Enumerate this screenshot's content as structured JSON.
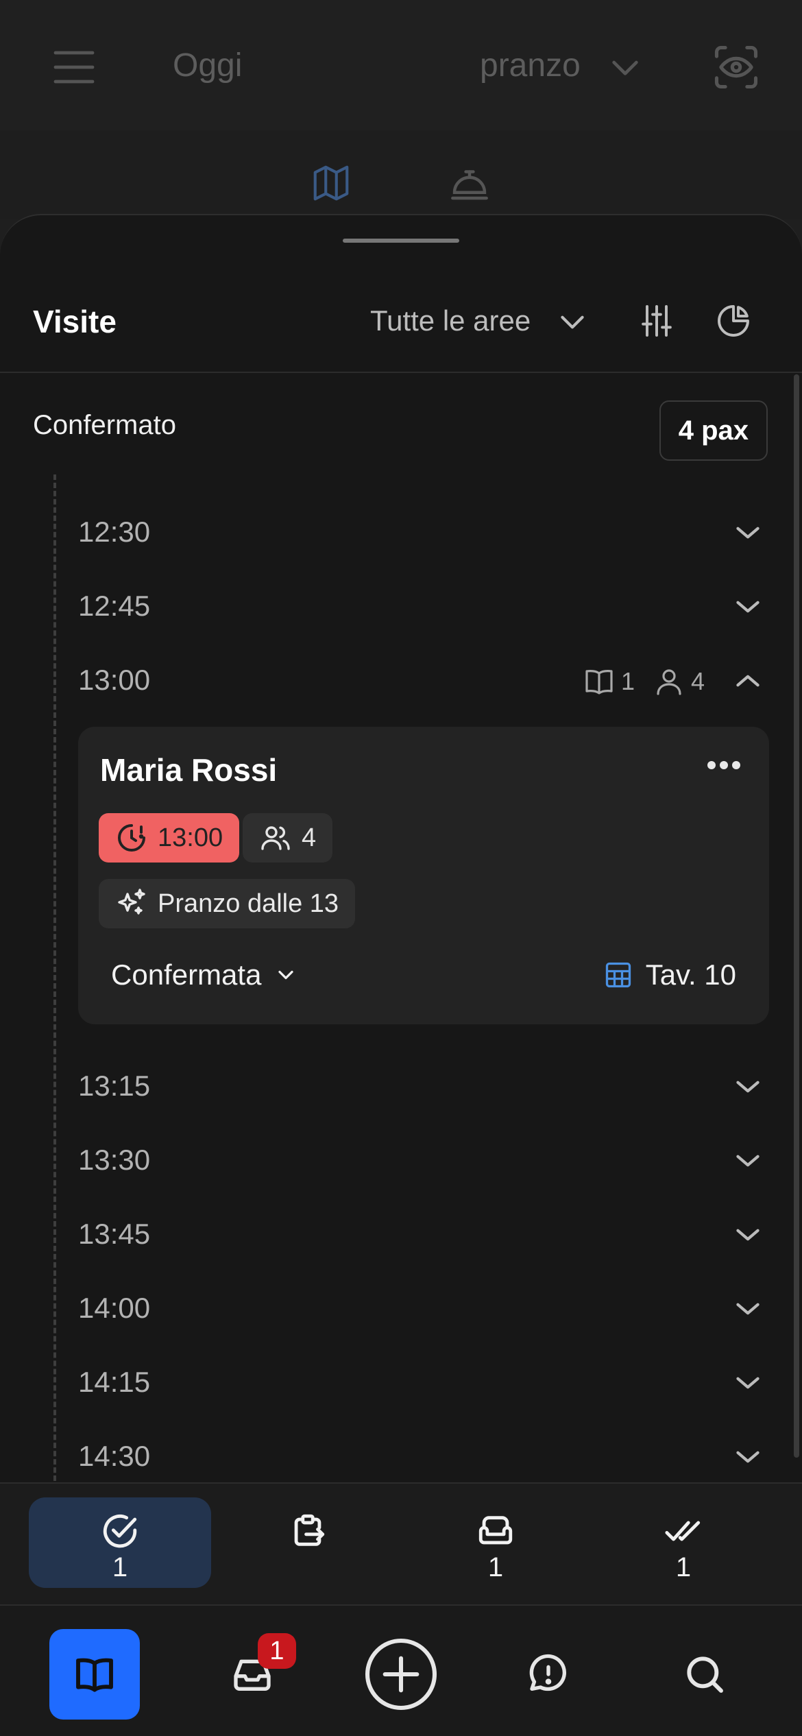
{
  "header": {
    "day_label": "Oggi",
    "service_label": "pranzo"
  },
  "sheet": {
    "title": "Visite",
    "area_filter": "Tutte le aree",
    "status_label": "Confermato",
    "pax_label": "4 pax"
  },
  "slots": [
    {
      "time": "12:30"
    },
    {
      "time": "12:45"
    },
    {
      "time": "13:00",
      "bookings": "1",
      "guests": "4"
    },
    {
      "time": "13:15"
    },
    {
      "time": "13:30"
    },
    {
      "time": "13:45"
    },
    {
      "time": "14:00"
    },
    {
      "time": "14:15"
    },
    {
      "time": "14:30"
    }
  ],
  "reservation": {
    "name": "Maria Rossi",
    "time": "13:00",
    "guests": "4",
    "offer": "Pranzo dalle 13",
    "status": "Confermata",
    "table": "Tav. 10"
  },
  "quick_tabs": [
    {
      "icon": "check-circle-icon",
      "count": "1",
      "active": true
    },
    {
      "icon": "clipboard-export-icon",
      "count": ""
    },
    {
      "icon": "sofa-icon",
      "count": "1"
    },
    {
      "icon": "double-check-icon",
      "count": "1"
    }
  ],
  "bottom_nav": {
    "inbox_badge": "1"
  },
  "colors": {
    "accent": "#1f6bff",
    "late": "#f06262",
    "table_icon": "#4a90e2",
    "badge": "#c8181e",
    "active_tab": "#23344e"
  }
}
